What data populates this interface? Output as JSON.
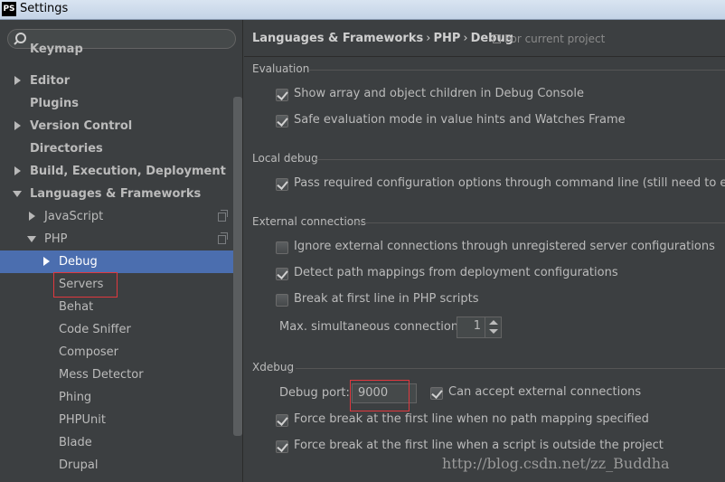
{
  "window": {
    "app_icon_text": "PS",
    "title": "Settings"
  },
  "search": {
    "placeholder": ""
  },
  "sidebar": {
    "items": [
      {
        "label": "Keymap"
      },
      {
        "label": "Editor"
      },
      {
        "label": "Plugins"
      },
      {
        "label": "Version Control"
      },
      {
        "label": "Directories"
      },
      {
        "label": "Build, Execution, Deployment"
      },
      {
        "label": "Languages & Frameworks"
      },
      {
        "label": "JavaScript"
      },
      {
        "label": "PHP"
      },
      {
        "label": "Debug"
      },
      {
        "label": "Servers"
      },
      {
        "label": "Behat"
      },
      {
        "label": "Code Sniffer"
      },
      {
        "label": "Composer"
      },
      {
        "label": "Mess Detector"
      },
      {
        "label": "Phing"
      },
      {
        "label": "PHPUnit"
      },
      {
        "label": "Blade"
      },
      {
        "label": "Drupal"
      }
    ]
  },
  "breadcrumb": {
    "part1": "Languages & Frameworks",
    "part2": "PHP",
    "part3": "Debug",
    "separator": "›",
    "scope": "For current project"
  },
  "groups": {
    "evaluation": {
      "title": "Evaluation",
      "show_array": "Show array and object children in Debug Console",
      "safe_eval": "Safe evaluation mode in value hints and Watches Frame"
    },
    "local_debug": {
      "title": "Local debug",
      "pass_required": "Pass required configuration options through command line (still need to enable d"
    },
    "external": {
      "title": "External connections",
      "ignore": "Ignore external connections through unregistered server configurations",
      "detect": "Detect path mappings from deployment configurations",
      "break_first": "Break at first line in PHP scripts",
      "max_label": "Max. simultaneous connections:",
      "max_value": "1"
    },
    "xdebug": {
      "title": "Xdebug",
      "port_label": "Debug port:",
      "port_value": "9000",
      "can_accept": "Can accept external connections",
      "force_break_no_mapping": "Force break at the first line when no path mapping specified",
      "force_break_outside": "Force break at the first line when a script is outside the project"
    }
  },
  "watermark": "http://blog.csdn.net/zz_Buddha",
  "colors": {
    "selection": "#4b6eaf",
    "background": "#3c3f41",
    "highlight_box": "#e0383e"
  }
}
